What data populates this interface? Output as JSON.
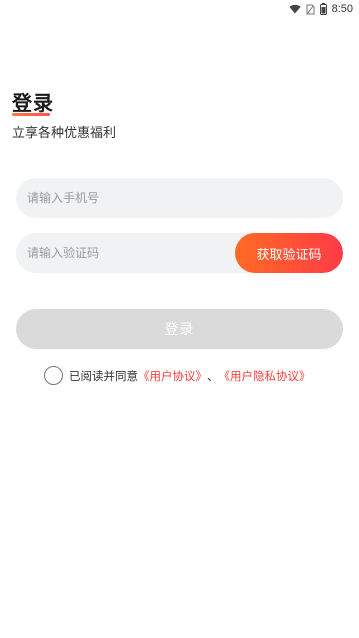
{
  "status_bar": {
    "time": "8:50"
  },
  "title": "登录",
  "subtitle": "立享各种优惠福利",
  "phone_input": {
    "placeholder": "请输入手机号",
    "value": ""
  },
  "code_input": {
    "placeholder": "请输入验证码",
    "value": ""
  },
  "get_code_button": "获取验证码",
  "login_button": "登录",
  "agreement": {
    "prefix": "已阅读并同意",
    "user_agreement": "《用户协议》",
    "separator": "、",
    "privacy_agreement": "《用户隐私协议》",
    "checked": false
  },
  "colors": {
    "accent_start": "#ff6a24",
    "accent_end": "#ff3b47",
    "link": "#ff3b3b",
    "disabled_button": "#dadada"
  }
}
